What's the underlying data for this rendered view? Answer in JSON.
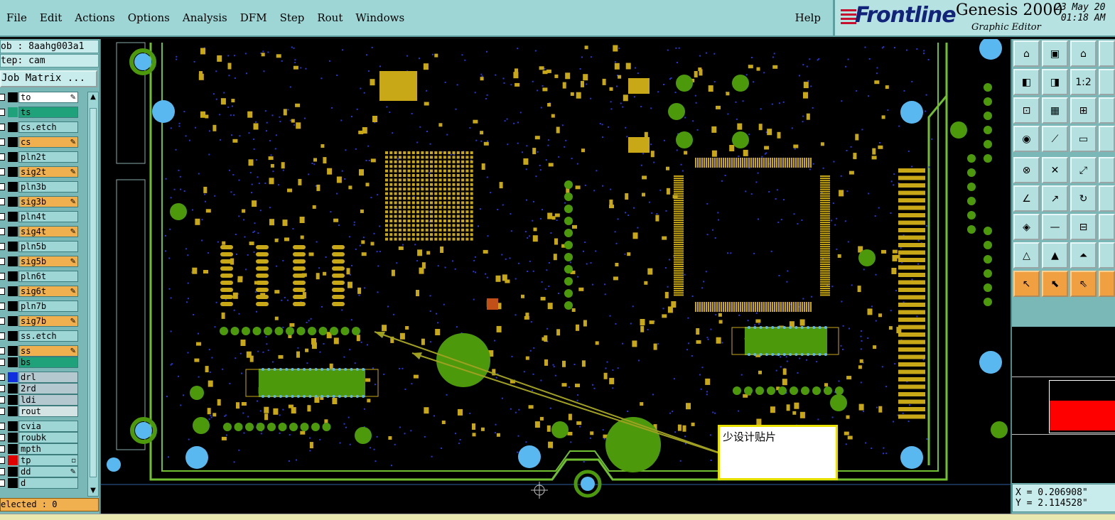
{
  "menu": {
    "items": [
      "File",
      "Edit",
      "Actions",
      "Options",
      "Analysis",
      "DFM",
      "Step",
      "Rout",
      "Windows"
    ],
    "help": "Help"
  },
  "brand": {
    "logo": "Frontline",
    "product": "Genesis 2000",
    "subtitle": "Graphic Editor",
    "date": "23 May 20",
    "time": "01:18 AM"
  },
  "job": {
    "job_line": "ob : 8aahg003a1",
    "step_line": "tep: cam",
    "job_matrix": "Job Matrix ..."
  },
  "layers": [
    {
      "name": "to",
      "state": "white",
      "swatch": "#000000",
      "flag": "edit"
    },
    {
      "name": "ts",
      "state": "green",
      "swatch": "#1fa27a",
      "flag": ""
    },
    {
      "name": "cs.etch",
      "state": "normal",
      "swatch": "#000000",
      "flag": ""
    },
    {
      "name": "cs",
      "state": "orange",
      "swatch": "#000000",
      "flag": "edit"
    },
    {
      "name": "pln2t",
      "state": "normal",
      "swatch": "#000000",
      "flag": ""
    },
    {
      "name": "sig2t",
      "state": "orange",
      "swatch": "#000000",
      "flag": "edit"
    },
    {
      "name": "pln3b",
      "state": "normal",
      "swatch": "#000000",
      "flag": ""
    },
    {
      "name": "sig3b",
      "state": "orange",
      "swatch": "#000000",
      "flag": "edit"
    },
    {
      "name": "pln4t",
      "state": "normal",
      "swatch": "#000000",
      "flag": ""
    },
    {
      "name": "sig4t",
      "state": "orange",
      "swatch": "#000000",
      "flag": "edit"
    },
    {
      "name": "pln5b",
      "state": "normal",
      "swatch": "#000000",
      "flag": ""
    },
    {
      "name": "sig5b",
      "state": "orange",
      "swatch": "#000000",
      "flag": "edit"
    },
    {
      "name": "pln6t",
      "state": "normal",
      "swatch": "#000000",
      "flag": ""
    },
    {
      "name": "sig6t",
      "state": "orange",
      "swatch": "#000000",
      "flag": "edit"
    },
    {
      "name": "pln7b",
      "state": "normal",
      "swatch": "#000000",
      "flag": ""
    },
    {
      "name": "sig7b",
      "state": "orange",
      "swatch": "#000000",
      "flag": "edit"
    },
    {
      "name": "ss.etch",
      "state": "normal",
      "swatch": "#000000",
      "flag": ""
    },
    {
      "name": "ss",
      "state": "orange",
      "swatch": "#000000",
      "flag": "edit"
    },
    {
      "name": "bs",
      "state": "green",
      "swatch": "#000000",
      "flag": ""
    },
    {
      "name": "drl",
      "state": "grey",
      "swatch": "#1030e0",
      "flag": ""
    },
    {
      "name": "2rd",
      "state": "grey",
      "swatch": "#000000",
      "flag": ""
    },
    {
      "name": "ldi",
      "state": "grey",
      "swatch": "#000000",
      "flag": ""
    },
    {
      "name": "rout",
      "state": "lgrey",
      "swatch": "#000000",
      "flag": ""
    },
    {
      "name": "cvia",
      "state": "normal",
      "swatch": "#000000",
      "flag": ""
    },
    {
      "name": "roubk",
      "state": "normal",
      "swatch": "#000000",
      "flag": ""
    },
    {
      "name": "mpth",
      "state": "normal",
      "swatch": "#000000",
      "flag": ""
    },
    {
      "name": "tp",
      "state": "normal",
      "swatch": "#e00000",
      "flag": "box"
    },
    {
      "name": "dd",
      "state": "normal",
      "swatch": "#000000",
      "flag": "edit"
    },
    {
      "name": "d",
      "state": "normal",
      "swatch": "#000000",
      "flag": ""
    }
  ],
  "selected_label": "elected : 0",
  "annotation": {
    "text": "少设计贴片"
  },
  "coords": {
    "x": "X = 0.206908\"",
    "y": "Y = 2.114528\""
  },
  "tools": [
    {
      "name": "zoom-home",
      "glyph": "⌂",
      "color": "cyan"
    },
    {
      "name": "zoom-in-page",
      "glyph": "▣",
      "color": "cyan"
    },
    {
      "name": "home-view",
      "glyph": "⌂",
      "color": "cyan"
    },
    {
      "name": "pan-left",
      "glyph": "◧",
      "color": "cyan"
    },
    {
      "name": "pan-right",
      "glyph": "◨",
      "color": "cyan"
    },
    {
      "name": "zoom-ratio",
      "glyph": "1:2",
      "color": "cyan"
    },
    {
      "name": "measure",
      "glyph": "⊡",
      "color": "cyan"
    },
    {
      "name": "layer-toggle",
      "glyph": "▦",
      "color": "cyan"
    },
    {
      "name": "graph",
      "glyph": "⊞",
      "color": "cyan"
    },
    {
      "name": "select",
      "glyph": "◉",
      "color": "cyan"
    },
    {
      "name": "line",
      "glyph": "⟋",
      "color": "cyan"
    },
    {
      "name": "ruler",
      "glyph": "▭",
      "color": "cyan"
    },
    {
      "name": "net",
      "glyph": "⊗",
      "color": "cyan"
    },
    {
      "name": "cross",
      "glyph": "✕",
      "color": "cyan"
    },
    {
      "name": "connect",
      "glyph": "⤢",
      "color": "cyan"
    },
    {
      "name": "angle",
      "glyph": "∠",
      "color": "cyan"
    },
    {
      "name": "arc",
      "glyph": "↗",
      "color": "cyan"
    },
    {
      "name": "rotate",
      "glyph": "↻",
      "color": "cyan"
    },
    {
      "name": "node",
      "glyph": "◈",
      "color": "cyan"
    },
    {
      "name": "split",
      "glyph": "—",
      "color": "cyan"
    },
    {
      "name": "align",
      "glyph": "⊟",
      "color": "cyan"
    },
    {
      "name": "triangle-a",
      "glyph": "△",
      "color": "cyan"
    },
    {
      "name": "triangle-b",
      "glyph": "▲",
      "color": "cyan"
    },
    {
      "name": "triangle-c",
      "glyph": "⏶",
      "color": "cyan"
    },
    {
      "name": "pointer-a",
      "glyph": "↖",
      "color": "orange"
    },
    {
      "name": "pointer-b",
      "glyph": "⬉",
      "color": "orange"
    },
    {
      "name": "pointer-c",
      "glyph": "⇖",
      "color": "orange"
    }
  ],
  "colors": {
    "copper": "#c9a818",
    "green_pad": "#4c9a0c",
    "via_blue": "#5ab8f0",
    "outline": "#6fbf30",
    "panel_cyan": "#9ed6d6"
  }
}
